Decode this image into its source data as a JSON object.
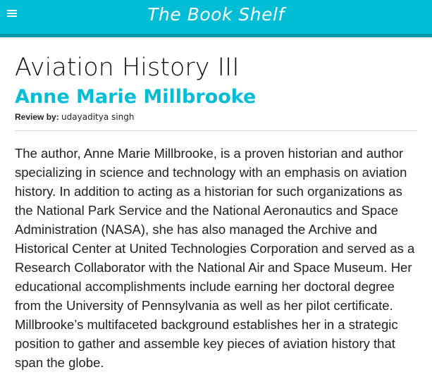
{
  "header": {
    "menu_icon": "hamburger-menu-icon",
    "brand_title": "The Book Shelf",
    "bar_color": "#00bcd4",
    "stripe_color": "#0097a7"
  },
  "book": {
    "title": "Aviation History III",
    "author": "Anne Marie Millbrooke",
    "author_color": "#00bcd4"
  },
  "review": {
    "label": "Review by:",
    "reviewer": "udayaditya singh",
    "body": "The author, Anne Marie Millbrooke, is a proven historian and author specializing in science and technology with an emphasis on aviation history. In addition to acting as a historian for such organizations as the National Park Service and the National Aeronautics and Space Administration (NASA), she has also managed the Archive and Historical Center at United Technologies Corporation and served as a Research Collaborator with the National Air and Space Museum. Her educational accomplishments include earning her doctoral degree from the University of Pennsylvania as well as her pilot certificate. Millbrooke’s multifaceted background establishes her in a strategic position to gather and assemble key pieces of aviation history that span the globe."
  }
}
